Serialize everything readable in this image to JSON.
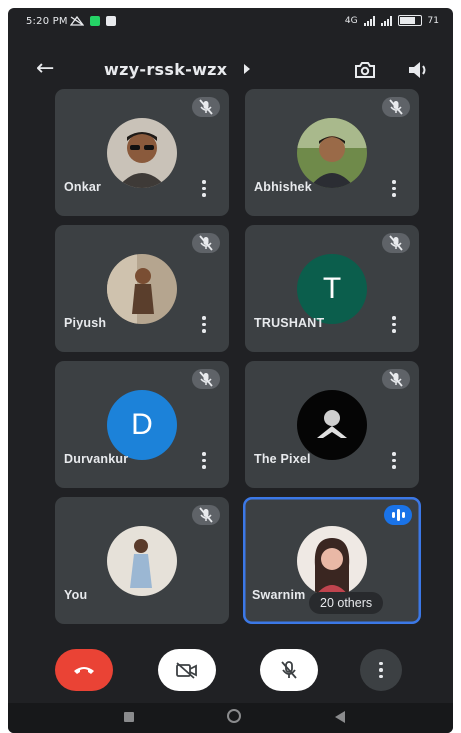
{
  "status_bar": {
    "time": "5:20 PM",
    "network": "4G",
    "battery": "71"
  },
  "meeting": {
    "code": "wzy-rssk-wzx"
  },
  "participants": [
    {
      "name": "Onkar",
      "avatar": "photo",
      "muted": true
    },
    {
      "name": "Abhishek",
      "avatar": "photo",
      "muted": true
    },
    {
      "name": "Piyush",
      "avatar": "photo",
      "muted": true
    },
    {
      "name": "TRUSHANT",
      "avatar": "letter",
      "initial": "T",
      "avatar_color": "#0b5e4c",
      "muted": true
    },
    {
      "name": "Durvankur",
      "avatar": "letter",
      "initial": "D",
      "avatar_color": "#1c82d9",
      "muted": true
    },
    {
      "name": "The Pixel",
      "avatar": "photo",
      "muted": true
    },
    {
      "name": "You",
      "avatar": "photo",
      "muted": true
    },
    {
      "name": "Swarnim",
      "avatar": "photo",
      "muted": false,
      "speaking": true,
      "others_label": "20 others"
    }
  ],
  "controls": {
    "end_call_color": "#ea4335",
    "camera": "off",
    "microphone": "off"
  },
  "colors": {
    "background": "#202124",
    "tile": "#3c4043",
    "accent": "#1a73e8"
  }
}
